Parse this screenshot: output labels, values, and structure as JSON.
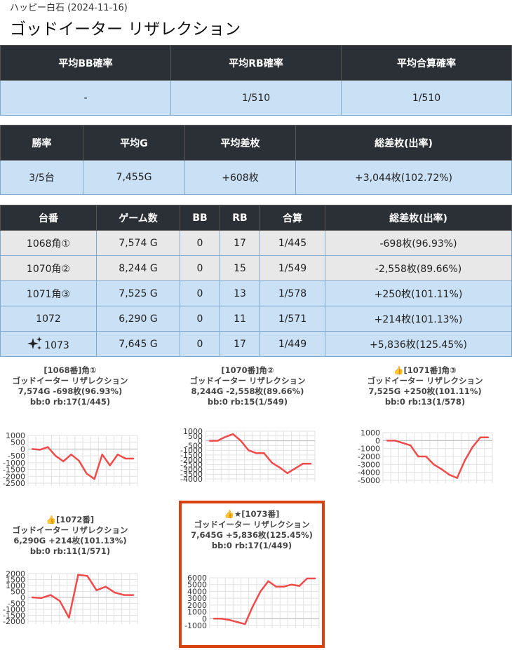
{
  "header": {
    "subtitle": "ハッピー白石 (2024-11-16)",
    "title": "ゴッドイーター リザレクション"
  },
  "summary_prob": {
    "headers": [
      "平均BB確率",
      "平均RB確率",
      "平均合算確率"
    ],
    "values": [
      "-",
      "1/510",
      "1/510"
    ]
  },
  "summary_stats": {
    "headers": [
      "勝率",
      "平均G",
      "平均差枚",
      "総差枚(出率)"
    ],
    "values": [
      "3/5台",
      "7,455G",
      "+608枚",
      "+3,044枚(102.72%)"
    ]
  },
  "machines": {
    "headers": [
      "台番",
      "ゲーム数",
      "BB",
      "RB",
      "合算",
      "総差枚(出率)"
    ],
    "rows": [
      [
        "1068角①",
        "7,574 G",
        "0",
        "17",
        "1/445",
        "-698枚(96.93%)"
      ],
      [
        "1070角②",
        "8,244 G",
        "0",
        "15",
        "1/549",
        "-2,558枚(89.66%)"
      ],
      [
        "1071角③",
        "7,525 G",
        "0",
        "13",
        "1/578",
        "+250枚(101.11%)"
      ],
      [
        "1072",
        "6,290 G",
        "0",
        "11",
        "1/571",
        "+214枚(101.13%)"
      ],
      [
        "1073",
        "7,645 G",
        "0",
        "17",
        "1/449",
        "+5,836枚(125.45%)"
      ]
    ]
  },
  "colors": {
    "line": "#f04b4b",
    "header_bg": "#2b3036",
    "row_blue": "#c9e0f5",
    "row_grey": "#e8e8e8",
    "link": "#2d7fd2",
    "highlight": "#d9410f"
  },
  "cards": [
    {
      "lines": [
        "[1068番]角①",
        "ゴッドイーター リザレクション",
        "7,574G -698枚(96.93%)",
        "bb:0 rb:17(1/445)"
      ]
    },
    {
      "lines": [
        "[1070番]角②",
        "ゴッドイーター リザレクション",
        "8,244G -2,558枚(89.66%)",
        "bb:0 rb:15(1/549)"
      ]
    },
    {
      "lines": [
        "👍[1071番]角③",
        "ゴッドイーター リザレクション",
        "7,525G +250枚(101.11%)",
        "bb:0 rb:13(1/578)"
      ]
    },
    {
      "lines": [
        "👍[1072番]",
        "ゴッドイーター リザレクション",
        "6,290G +214枚(101.13%)",
        "bb:0 rb:11(1/571)"
      ]
    },
    {
      "lines": [
        "👍★[1073番]",
        "ゴッドイーター リザレクション",
        "7,645G +5,836枚(125.45%)",
        "bb:0 rb:17(1/449)"
      ]
    }
  ],
  "chart_data": [
    {
      "type": "line",
      "ylim": [
        -2500,
        1000
      ],
      "yticks": [
        "1000",
        "500",
        "0",
        "-500",
        "-1000",
        "-1500",
        "-2000",
        "-2500"
      ],
      "values": [
        0,
        -50,
        150,
        -500,
        -900,
        -400,
        -850,
        -1800,
        -2200,
        -400,
        -1200,
        -400,
        -700,
        -700
      ]
    },
    {
      "type": "line",
      "ylim": [
        -4000,
        1000
      ],
      "yticks": [
        "1000",
        "500",
        "0",
        "-500",
        "-1000",
        "-1500",
        "-2000",
        "-2500",
        "-3000",
        "-3500",
        "-4000"
      ],
      "values": [
        0,
        0,
        400,
        700,
        0,
        -1000,
        -1300,
        -1300,
        -2300,
        -2800,
        -3400,
        -2900,
        -2400,
        -2400
      ]
    },
    {
      "type": "line",
      "ylim": [
        -5000,
        1000
      ],
      "yticks": [
        "1000",
        "0",
        "-1000",
        "-2000",
        "-3000",
        "-4000",
        "-5000"
      ],
      "values": [
        0,
        0,
        -300,
        -600,
        -2000,
        -2000,
        -3000,
        -3600,
        -4300,
        -4700,
        -2500,
        -800,
        400,
        400
      ]
    },
    {
      "type": "line",
      "ylim": [
        -2000,
        2000
      ],
      "yticks": [
        "2000",
        "1500",
        "1000",
        "500",
        "0",
        "-500",
        "-1000",
        "-1500",
        "-2000"
      ],
      "values": [
        0,
        -50,
        200,
        -300,
        -1700,
        1900,
        1800,
        600,
        900,
        400,
        200,
        200
      ]
    },
    {
      "type": "line",
      "ylim": [
        -1000,
        6000
      ],
      "yticks": [
        "6000",
        "5000",
        "4000",
        "3000",
        "2000",
        "1000",
        "0",
        "-1000"
      ],
      "values": [
        0,
        0,
        -200,
        -500,
        -800,
        1800,
        4000,
        5500,
        4700,
        4700,
        5000,
        4800,
        5900,
        5900
      ]
    }
  ]
}
